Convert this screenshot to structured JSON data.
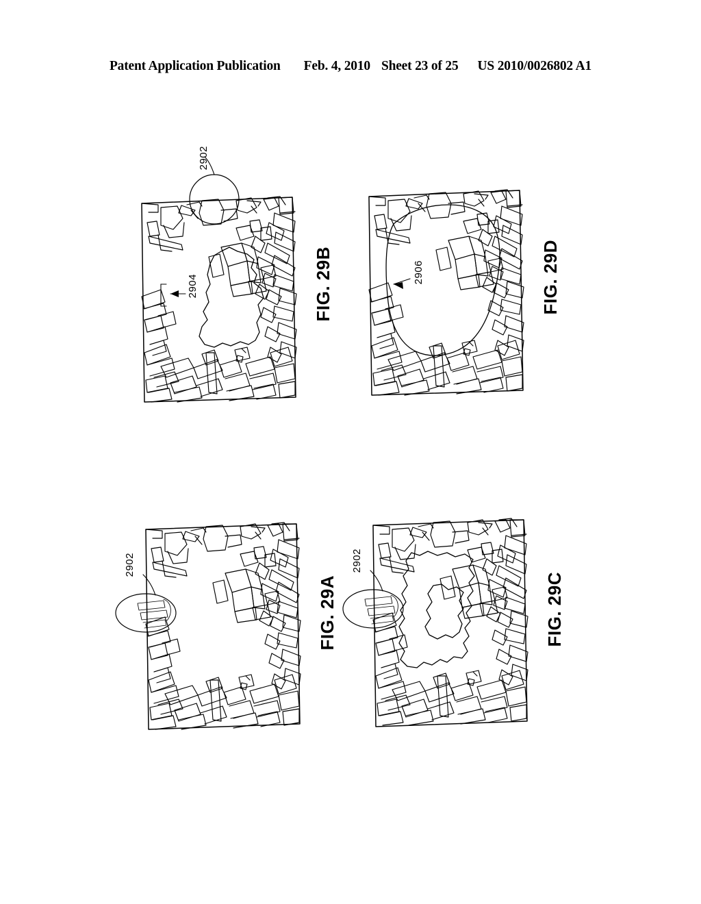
{
  "header": {
    "publication": "Patent Application Publication",
    "date": "Feb. 4, 2010",
    "sheet": "Sheet 23 of 25",
    "patent_number": "US 2010/0026802 A1"
  },
  "figures": [
    {
      "id": "fig-29a",
      "caption": "FIG. 29A",
      "position": "bottom-left",
      "description": "Line drawing of a cluttered room scene with no segmented region highlighted",
      "reference_numerals": [
        {
          "label": "2902",
          "type": "callout-ellipse",
          "note": "circled hand region at left edge"
        }
      ]
    },
    {
      "id": "fig-29b",
      "caption": "FIG. 29B",
      "position": "top-left",
      "description": "Line drawing of the room scene with an irregular segmented region outlined in the center",
      "reference_numerals": [
        {
          "label": "2902",
          "type": "callout-circle",
          "note": "circled hand region at top edge"
        },
        {
          "label": "2904",
          "type": "arrow",
          "note": "points to segmented region boundary"
        }
      ]
    },
    {
      "id": "fig-29c",
      "caption": "FIG. 29C",
      "position": "bottom-right",
      "description": "Line drawing of the room scene with a jagged segmented region outlined in the center",
      "reference_numerals": [
        {
          "label": "2902",
          "type": "callout-ellipse",
          "note": "circled hand region at left edge"
        }
      ]
    },
    {
      "id": "fig-29d",
      "caption": "FIG. 29D",
      "position": "top-right",
      "description": "Line drawing of the room scene with a smoothed segmented region outlined in the center",
      "reference_numerals": [
        {
          "label": "2906",
          "type": "arrow",
          "note": "points to smoothed segmented region"
        }
      ]
    }
  ],
  "colors": {
    "ink": "#000000",
    "page": "#ffffff"
  }
}
